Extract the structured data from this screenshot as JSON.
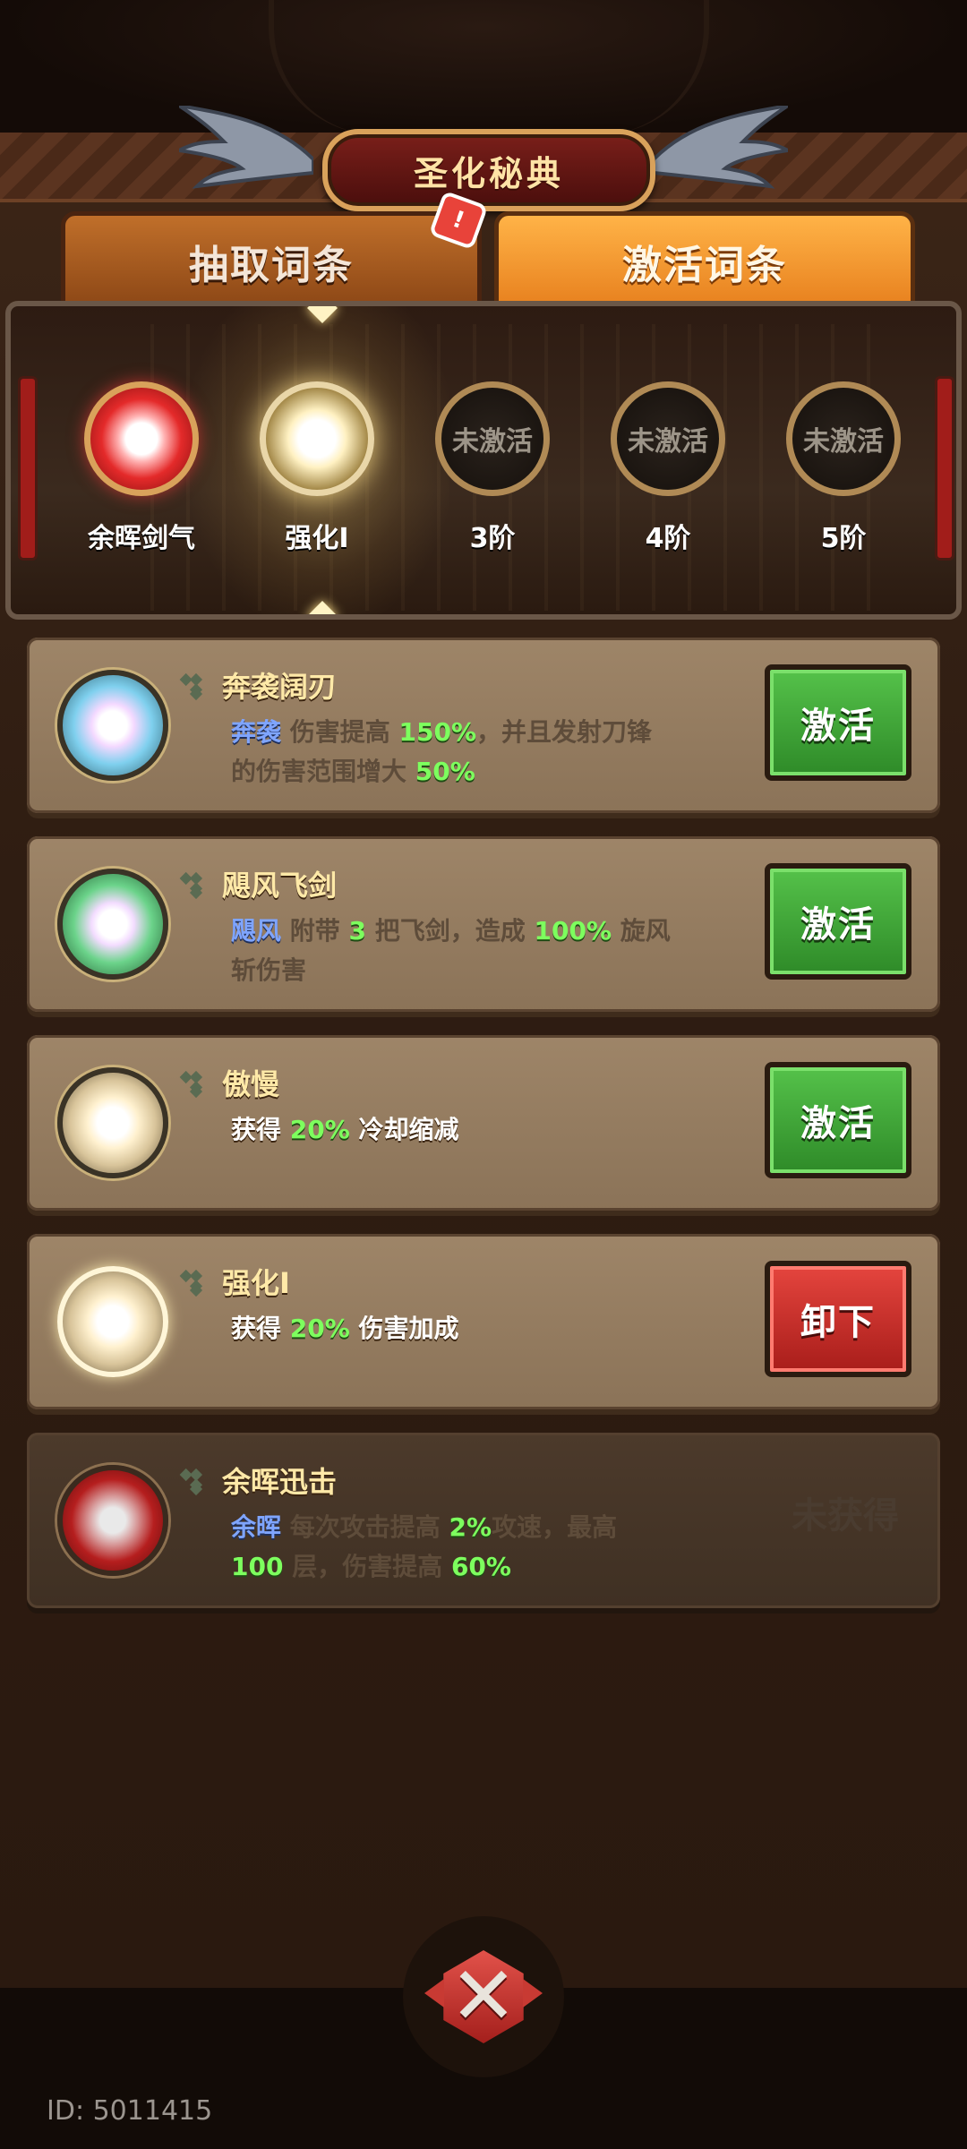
{
  "header": {
    "title": "圣化秘典"
  },
  "tabs": [
    {
      "label": "抽取词条",
      "active": false
    },
    {
      "label": "激活词条",
      "active": true
    }
  ],
  "alert_badge": "!",
  "stages": [
    {
      "label": "余晖剑气",
      "state": "active-red",
      "overlay": ""
    },
    {
      "label": "强化I",
      "state": "active-gold",
      "overlay": ""
    },
    {
      "label": "3阶",
      "state": "locked",
      "overlay": "未激活"
    },
    {
      "label": "4阶",
      "state": "locked",
      "overlay": "未激活"
    },
    {
      "label": "5阶",
      "state": "locked",
      "overlay": "未激活"
    }
  ],
  "cards": [
    {
      "name": "奔袭阔刃",
      "orb": "blue",
      "desc_line1": {
        "kw": "奔袭",
        "t1": " 伤害提高 ",
        "n1": "150%",
        "t2": "，并且发射刀锋"
      },
      "desc_line2": {
        "t1": "的伤害范围增大 ",
        "n1": "50%"
      },
      "button": "激活"
    },
    {
      "name": "飓风飞剑",
      "orb": "green",
      "desc_line1": {
        "kw": "飓风",
        "t1": " 附带 ",
        "n1": "3",
        "t2": " 把飞剑，造成 ",
        "n2": "100%",
        "t3": " 旋风"
      },
      "desc_line2": {
        "t1": "斩伤害"
      },
      "button": "激活"
    },
    {
      "name": "傲慢",
      "orb": "cream",
      "desc_line1": {
        "t1": "获得 ",
        "n1": "20%",
        "t2": " 冷却缩减"
      },
      "button": "激活"
    },
    {
      "name": "强化I",
      "orb": "gold",
      "desc_line1": {
        "t1": "获得 ",
        "n1": "20%",
        "t2": " 伤害加成"
      },
      "button": "卸下"
    },
    {
      "name": "余晖迅击",
      "orb": "red",
      "desc_line1": {
        "kw": "余晖",
        "t1": " 每次攻击提高 ",
        "n1": "2%",
        "t2": "攻速，最高"
      },
      "desc_line2": {
        "n1": "100",
        "t1": " 层，伤害提高 ",
        "n2": "60%"
      },
      "status": "未获得"
    }
  ],
  "footer": {
    "id_text": "ID: 5011415"
  },
  "colors": {
    "accent_orange": "#e7801e",
    "activate_green": "#2e8a28",
    "unequip_red": "#a81d1a",
    "keyword_blue": "#7fa5ff",
    "number_green": "#7dff5e"
  }
}
